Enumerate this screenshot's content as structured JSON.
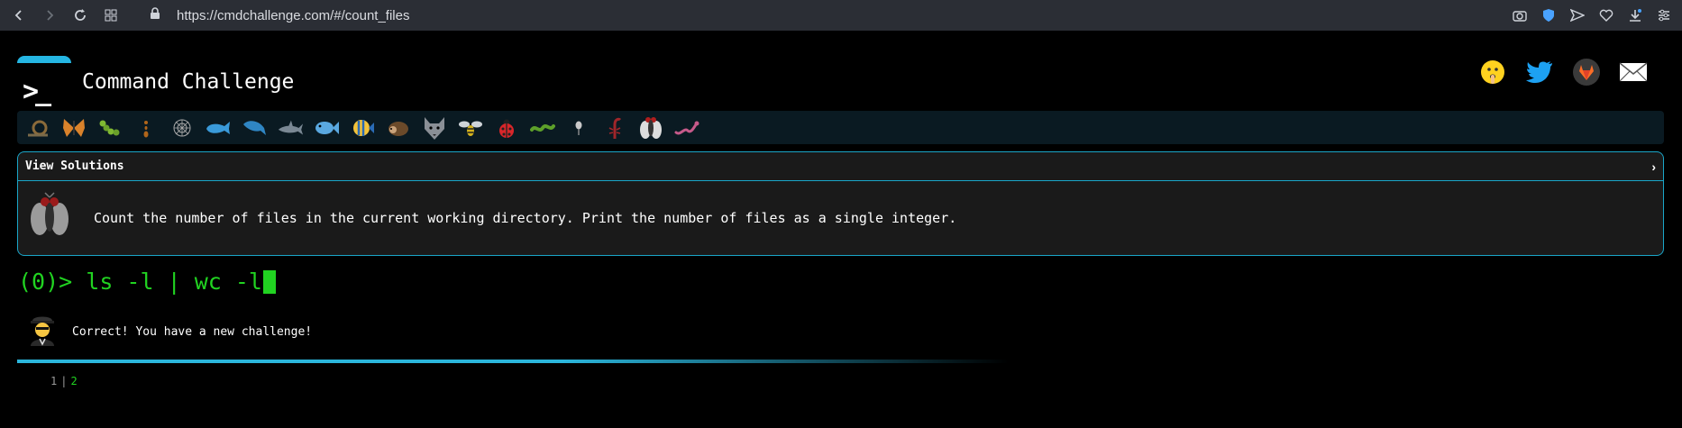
{
  "browser": {
    "url": "https://cmdchallenge.com/#/count_files"
  },
  "header": {
    "title": "Command Challenge",
    "logo_glyph": ">_"
  },
  "social": [
    "emoji-face-icon",
    "twitter-icon",
    "gitlab-icon",
    "mail-icon"
  ],
  "challenge_icons": [
    "snail-icon",
    "butterfly-icon",
    "caterpillar-icon",
    "ant-icon",
    "web-icon",
    "whale-icon",
    "dolphin-icon",
    "shark-icon",
    "fish-icon",
    "tropical-fish-icon",
    "hedgehog-icon",
    "wolf-icon",
    "bee-icon",
    "ladybug-icon",
    "worm-icon",
    "bug-icon",
    "scorpion-icon",
    "fly-icon",
    "snake-icon"
  ],
  "panel": {
    "title": "View Solutions",
    "task": "Count the number of files in the current working directory. Print the number of files as a single integer."
  },
  "prompt": {
    "counter": "(0)>",
    "command": "ls -l | wc -l"
  },
  "result": {
    "message": "Correct! You have a new challenge!"
  },
  "output": {
    "line_number": "1",
    "value": "2"
  },
  "colors": {
    "accent": "#1aa6c9",
    "terminal_green": "#21d321"
  }
}
